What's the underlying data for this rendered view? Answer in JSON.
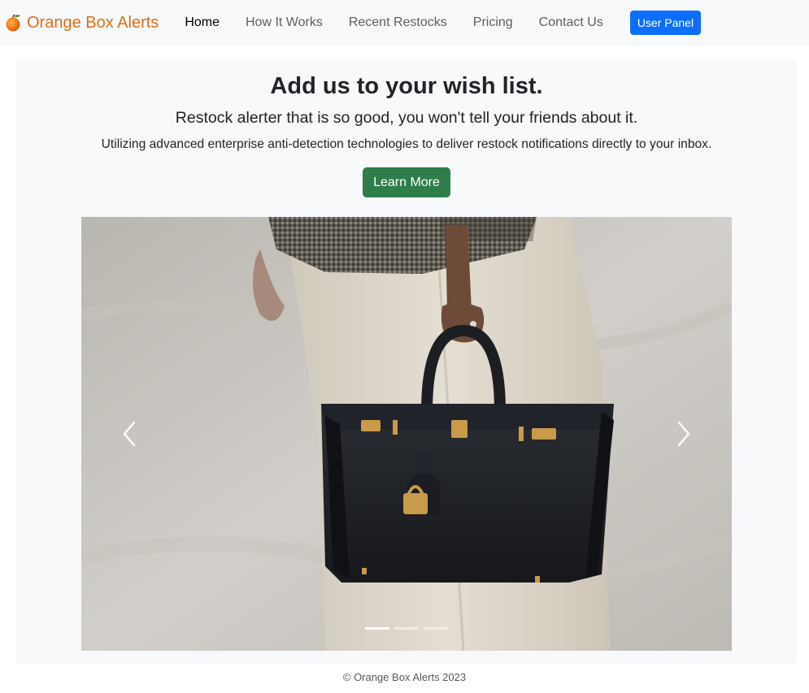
{
  "nav": {
    "brand_text": "Orange Box Alerts",
    "brand_icon": "orange-fruit-icon",
    "links": [
      {
        "label": "Home",
        "active": true
      },
      {
        "label": "How It Works",
        "active": false
      },
      {
        "label": "Recent Restocks",
        "active": false
      },
      {
        "label": "Pricing",
        "active": false
      },
      {
        "label": "Contact Us",
        "active": false
      }
    ],
    "panel_button": "User Panel"
  },
  "hero": {
    "title": "Add us to your wish list.",
    "lead": "Restock alerter that is so good, you won't tell your friends about it.",
    "description": "Utilizing advanced enterprise anti-detection technologies to deliver restock notifications directly to your inbox.",
    "button_label": "Learn More"
  },
  "carousel": {
    "slide_count": 3,
    "active_slide": 1,
    "prev_icon": "chevron-left-icon",
    "next_icon": "chevron-right-icon"
  },
  "footer": {
    "text": "© Orange Box Alerts 2023"
  },
  "colors": {
    "brand": "#e06c1a",
    "primary_button": "#0d6efd",
    "success_button": "#2e7d4a",
    "navbar_bg": "#f8f9fa"
  }
}
